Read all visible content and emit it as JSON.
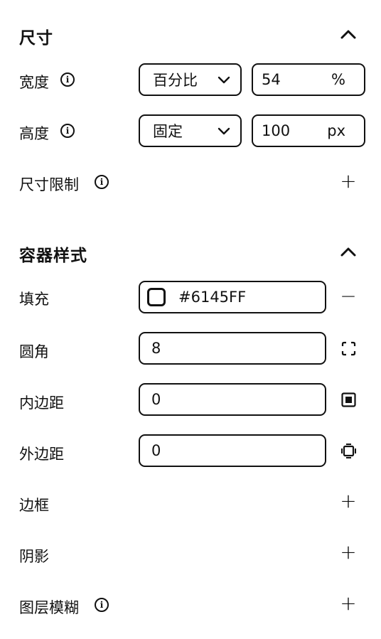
{
  "size_section": {
    "title": "尺寸",
    "width": {
      "label": "宽度",
      "mode": "百分比",
      "value": "54",
      "unit": "%"
    },
    "height": {
      "label": "高度",
      "mode": "固定",
      "value": "100",
      "unit": "px"
    },
    "constraints": {
      "label": "尺寸限制"
    }
  },
  "container_section": {
    "title": "容器样式",
    "fill": {
      "label": "填充",
      "value": "#6145FF"
    },
    "radius": {
      "label": "圆角",
      "value": "8"
    },
    "padding": {
      "label": "内边距",
      "value": "0"
    },
    "margin": {
      "label": "外边距",
      "value": "0"
    },
    "border": {
      "label": "边框"
    },
    "shadow": {
      "label": "阴影"
    },
    "blur": {
      "label": "图层模糊"
    }
  },
  "icons": {
    "info": "i",
    "plus": "+",
    "minus": "−"
  }
}
